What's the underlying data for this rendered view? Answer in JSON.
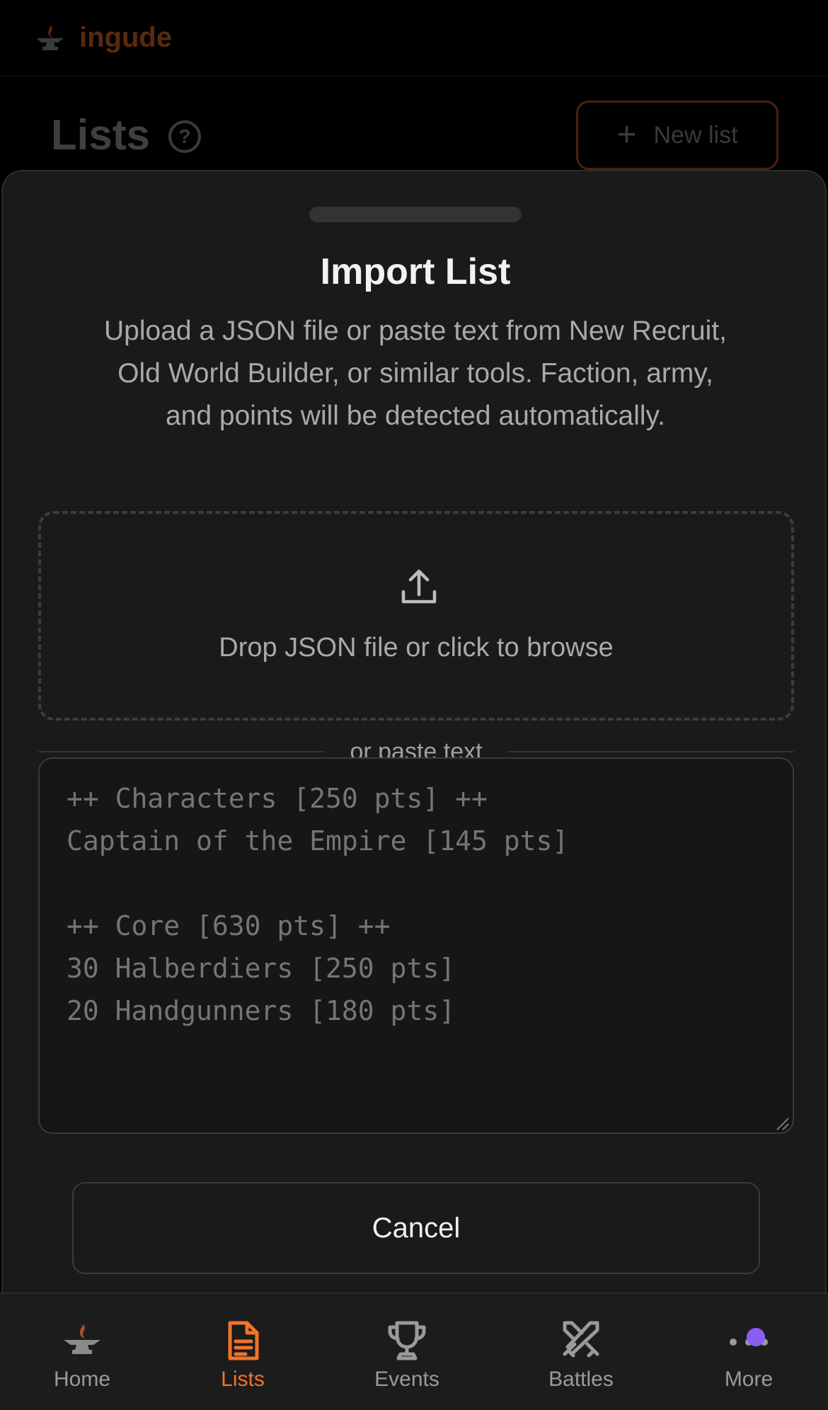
{
  "header": {
    "brand_name": "ingude",
    "brand_icon": "anvil-flame-icon",
    "page_title": "Lists",
    "help_icon": "question-circle-icon",
    "new_list_label": "New list"
  },
  "import_sheet": {
    "title": "Import List",
    "description": "Upload a JSON file or paste text from New Recruit, Old World Builder, or similar tools. Faction, army, and points will be detected automatically.",
    "dropzone_icon": "upload-icon",
    "dropzone_label": "Drop JSON file or click to browse",
    "divider_label": "or paste text",
    "paste_placeholder": "++ Characters [250 pts] ++\nCaptain of the Empire [145 pts]\n\n++ Core [630 pts] ++\n30 Halberdiers [250 pts]\n20 Handgunners [180 pts]",
    "cancel_label": "Cancel"
  },
  "tabbar": {
    "active": "Lists",
    "items": [
      {
        "label": "Home",
        "icon": "anvil-icon"
      },
      {
        "label": "Lists",
        "icon": "document-icon"
      },
      {
        "label": "Events",
        "icon": "trophy-icon"
      },
      {
        "label": "Battles",
        "icon": "crossed-swords-icon"
      },
      {
        "label": "More",
        "icon": "more-dots-icon"
      }
    ]
  },
  "colors": {
    "accent": "#f0742a",
    "badge": "#8b5cf6",
    "sheet_bg": "#1a1a1a"
  }
}
